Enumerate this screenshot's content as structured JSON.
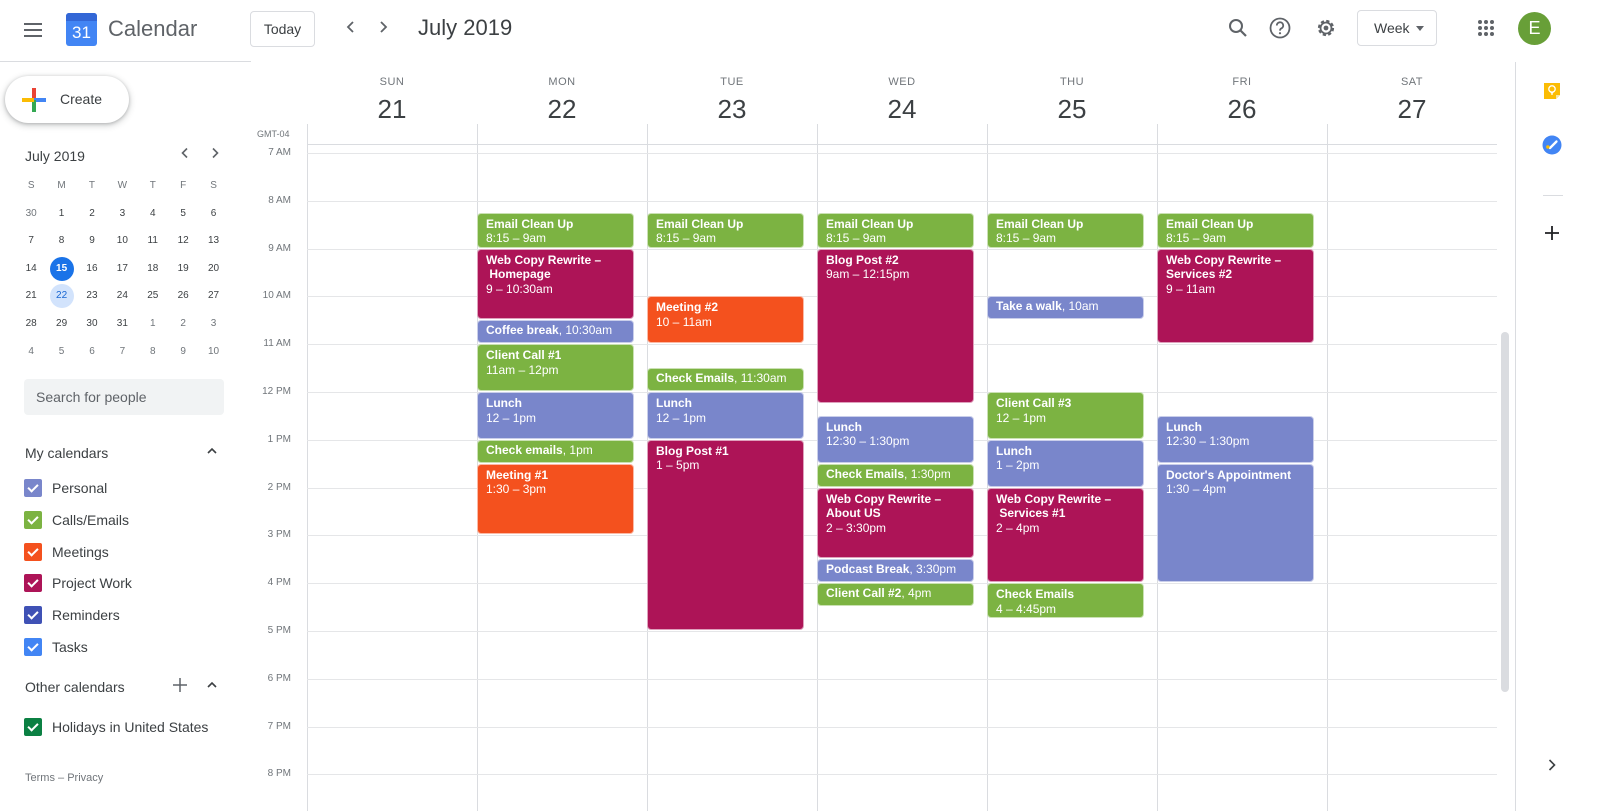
{
  "header": {
    "app_name": "Calendar",
    "logo_day": "31",
    "today_label": "Today",
    "period_title": "July 2019",
    "view_label": "Week",
    "avatar_initial": "E",
    "icons": [
      "menu-icon",
      "prev-icon",
      "next-icon",
      "search-icon",
      "help-icon",
      "settings-icon",
      "apps-grid-icon"
    ]
  },
  "sidebar": {
    "create_label": "Create",
    "mini_calendar": {
      "title": "July 2019",
      "dow": [
        "S",
        "M",
        "T",
        "W",
        "T",
        "F",
        "S"
      ],
      "weeks": [
        [
          "30",
          "1",
          "2",
          "3",
          "4",
          "5",
          "6"
        ],
        [
          "7",
          "8",
          "9",
          "10",
          "11",
          "12",
          "13"
        ],
        [
          "14",
          "15",
          "16",
          "17",
          "18",
          "19",
          "20"
        ],
        [
          "21",
          "22",
          "23",
          "24",
          "25",
          "26",
          "27"
        ],
        [
          "28",
          "29",
          "30",
          "31",
          "1",
          "2",
          "3"
        ],
        [
          "4",
          "5",
          "6",
          "7",
          "8",
          "9",
          "10"
        ]
      ],
      "today": "15",
      "selected": "22"
    },
    "search_placeholder": "Search for people",
    "my_calendars_label": "My calendars",
    "my_calendars": [
      {
        "label": "Personal",
        "color": "#7986cb"
      },
      {
        "label": "Calls/Emails",
        "color": "#7cb342"
      },
      {
        "label": "Meetings",
        "color": "#f4511e"
      },
      {
        "label": "Project Work",
        "color": "#ad1457"
      },
      {
        "label": "Reminders",
        "color": "#3f51b5"
      },
      {
        "label": "Tasks",
        "color": "#4285f4"
      }
    ],
    "other_calendars_label": "Other calendars",
    "other_calendars": [
      {
        "label": "Holidays in United States",
        "color": "#0b8043"
      }
    ],
    "footer": {
      "terms": "Terms",
      "sep": "–",
      "privacy": "Privacy"
    }
  },
  "week": {
    "timezone": "GMT-04",
    "days": [
      {
        "dow": "SUN",
        "num": "21"
      },
      {
        "dow": "MON",
        "num": "22"
      },
      {
        "dow": "TUE",
        "num": "23"
      },
      {
        "dow": "WED",
        "num": "24"
      },
      {
        "dow": "THU",
        "num": "25"
      },
      {
        "dow": "FRI",
        "num": "26"
      },
      {
        "dow": "SAT",
        "num": "27"
      }
    ],
    "hours": [
      "7 AM",
      "8 AM",
      "9 AM",
      "10 AM",
      "11 AM",
      "12 PM",
      "1 PM",
      "2 PM",
      "3 PM",
      "4 PM",
      "5 PM",
      "6 PM",
      "7 PM",
      "8 PM"
    ],
    "events": [
      {
        "day": 1,
        "start": 8.25,
        "end": 9,
        "title": "Email Clean Up",
        "time": "8:15 – 9am",
        "calendar": "Calls/Emails"
      },
      {
        "day": 1,
        "start": 9,
        "end": 10.5,
        "title": "Web Copy Rewrite – Homepage",
        "time": "9 – 10:30am",
        "calendar": "Project Work"
      },
      {
        "day": 1,
        "start": 10.5,
        "end": 11,
        "title": "Coffee break",
        "time": "10:30am",
        "inline": true,
        "calendar": "Personal"
      },
      {
        "day": 1,
        "start": 11,
        "end": 12,
        "title": "Client Call #1",
        "time": "11am – 12pm",
        "calendar": "Calls/Emails"
      },
      {
        "day": 1,
        "start": 12,
        "end": 13,
        "title": "Lunch",
        "time": "12 – 1pm",
        "calendar": "Personal"
      },
      {
        "day": 1,
        "start": 13,
        "end": 13.5,
        "title": "Check emails",
        "time": "1pm",
        "inline": true,
        "calendar": "Calls/Emails"
      },
      {
        "day": 1,
        "start": 13.5,
        "end": 15,
        "title": "Meeting #1",
        "time": "1:30 – 3pm",
        "calendar": "Meetings"
      },
      {
        "day": 2,
        "start": 8.25,
        "end": 9,
        "title": "Email Clean Up",
        "time": "8:15 – 9am",
        "calendar": "Calls/Emails"
      },
      {
        "day": 2,
        "start": 10,
        "end": 11,
        "title": "Meeting #2",
        "time": "10 – 11am",
        "calendar": "Meetings"
      },
      {
        "day": 2,
        "start": 11.5,
        "end": 12,
        "title": "Check Emails",
        "time": "11:30am",
        "inline": true,
        "calendar": "Calls/Emails"
      },
      {
        "day": 2,
        "start": 12,
        "end": 13,
        "title": "Lunch",
        "time": "12 – 1pm",
        "calendar": "Personal"
      },
      {
        "day": 2,
        "start": 13,
        "end": 17,
        "title": "Blog Post #1",
        "time": "1 – 5pm",
        "calendar": "Project Work"
      },
      {
        "day": 3,
        "start": 8.25,
        "end": 9,
        "title": "Email Clean Up",
        "time": "8:15 – 9am",
        "calendar": "Calls/Emails"
      },
      {
        "day": 3,
        "start": 9,
        "end": 12.25,
        "title": "Blog Post #2",
        "time": "9am – 12:15pm",
        "calendar": "Project Work"
      },
      {
        "day": 3,
        "start": 12.5,
        "end": 13.5,
        "title": "Lunch",
        "time": "12:30 – 1:30pm",
        "calendar": "Personal"
      },
      {
        "day": 3,
        "start": 13.5,
        "end": 14,
        "title": "Check Emails",
        "time": "1:30pm",
        "inline": true,
        "calendar": "Calls/Emails"
      },
      {
        "day": 3,
        "start": 14,
        "end": 15.5,
        "title": "Web Copy Rewrite – About US",
        "time": "2 – 3:30pm",
        "calendar": "Project Work"
      },
      {
        "day": 3,
        "start": 15.5,
        "end": 16,
        "title": "Podcast Break",
        "time": "3:30pm",
        "inline": true,
        "calendar": "Personal"
      },
      {
        "day": 3,
        "start": 16,
        "end": 16.5,
        "title": "Client Call #2",
        "time": "4pm",
        "inline": true,
        "calendar": "Calls/Emails"
      },
      {
        "day": 4,
        "start": 8.25,
        "end": 9,
        "title": "Email Clean Up",
        "time": "8:15 – 9am",
        "calendar": "Calls/Emails"
      },
      {
        "day": 4,
        "start": 10,
        "end": 10.5,
        "title": "Take a walk",
        "time": "10am",
        "inline": true,
        "calendar": "Personal"
      },
      {
        "day": 4,
        "start": 12,
        "end": 13,
        "title": "Client Call #3",
        "time": "12 – 1pm",
        "calendar": "Calls/Emails"
      },
      {
        "day": 4,
        "start": 13,
        "end": 14,
        "title": "Lunch",
        "time": "1 – 2pm",
        "calendar": "Personal"
      },
      {
        "day": 4,
        "start": 14,
        "end": 16,
        "title": "Web Copy Rewrite – Services #1",
        "time": "2 – 4pm",
        "calendar": "Project Work"
      },
      {
        "day": 4,
        "start": 16,
        "end": 16.75,
        "title": "Check Emails",
        "time": "4 – 4:45pm",
        "calendar": "Calls/Emails"
      },
      {
        "day": 5,
        "start": 8.25,
        "end": 9,
        "title": "Email Clean Up",
        "time": "8:15 – 9am",
        "calendar": "Calls/Emails"
      },
      {
        "day": 5,
        "start": 9,
        "end": 11,
        "title": "Web Copy Rewrite – Services #2",
        "time": "9 – 11am",
        "calendar": "Project Work"
      },
      {
        "day": 5,
        "start": 12.5,
        "end": 13.5,
        "title": "Lunch",
        "time": "12:30 – 1:30pm",
        "calendar": "Personal"
      },
      {
        "day": 5,
        "start": 13.5,
        "end": 16,
        "title": "Doctor's Appointment",
        "time": "1:30 – 4pm",
        "calendar": "Personal"
      }
    ]
  },
  "side_panel": {
    "icons": [
      "keep-icon",
      "tasks-icon",
      "add-addon-icon",
      "expand-panel-icon"
    ]
  }
}
